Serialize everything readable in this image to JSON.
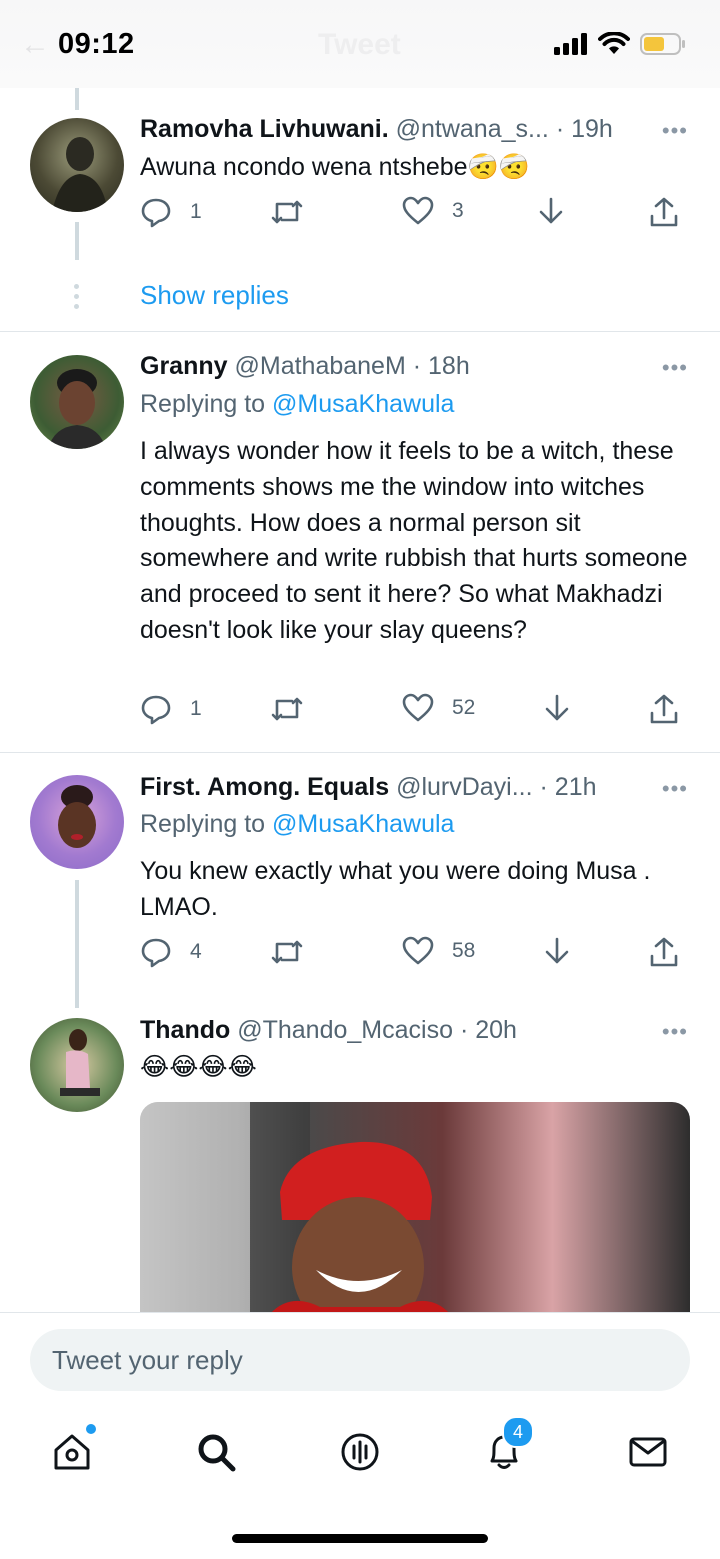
{
  "status_bar": {
    "time": "09:12",
    "header_title": "Tweet"
  },
  "tweets": [
    {
      "name": "Ramovha Livhuwani.",
      "handle": "@ntwana_s...",
      "time": "· 19h",
      "text": "Awuna ncondo wena ntshebe🤕🤕",
      "reply_count": "1",
      "retweet_count": "",
      "like_count": "3",
      "show_replies": "Show replies"
    },
    {
      "name": "Granny",
      "handle": "@MathabaneM",
      "time": "· 18h",
      "replying_prefix": "Replying to",
      "replying_to": "@MusaKhawula",
      "text": "I always wonder how it feels to be a witch, these comments shows me the window into witches thoughts. How does a normal person  sit somewhere and write rubbish that hurts someone and proceed to sent it here? So what Makhadzi doesn't look like your slay queens?",
      "reply_count": "1",
      "retweet_count": "",
      "like_count": "52"
    },
    {
      "name": "First. Among. Equals",
      "handle": "@lurvDayi...",
      "time": "· 21h",
      "replying_prefix": "Replying to",
      "replying_to": "@MusaKhawula",
      "text": "You knew exactly what you were doing Musa . LMAO.",
      "reply_count": "4",
      "retweet_count": "",
      "like_count": "58"
    },
    {
      "name": "Thando",
      "handle": "@Thando_Mcaciso",
      "time": "· 20h",
      "text": "😂😂😂😂"
    }
  ],
  "reply_bar": {
    "placeholder": "Tweet your reply"
  },
  "tab_bar": {
    "tabs": [
      {
        "icon": "home-icon"
      },
      {
        "icon": "search-icon"
      },
      {
        "icon": "spaces-icon"
      },
      {
        "icon": "notifications-icon",
        "badge": "4"
      },
      {
        "icon": "messages-icon"
      }
    ]
  },
  "colors": {
    "accent": "#1d9bf0",
    "text": "#0f1419",
    "secondary": "#536471"
  }
}
